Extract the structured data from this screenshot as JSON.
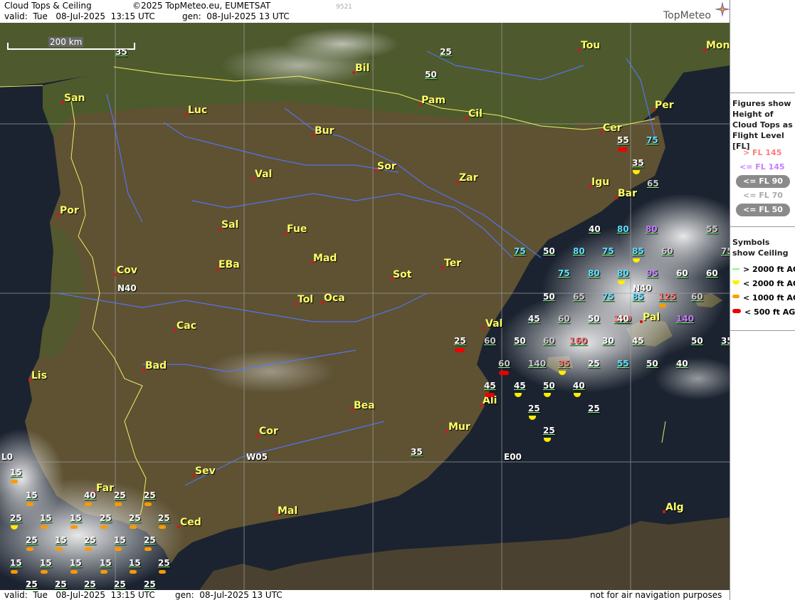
{
  "header": {
    "product": "Cloud Tops & Ceiling",
    "copyright": "©2025 TopMeteo.eu, EUMETSAT",
    "valid": "valid:  Tue   08-Jul-2025  13:15 UTC",
    "gen": "gen:  08-Jul-2025 13 UTC",
    "code": "9521",
    "brand": "TopMeteo"
  },
  "footer": {
    "valid": "valid:  Tue   08-Jul-2025  13:15 UTC",
    "gen": "gen:  08-Jul-2025 13 UTC",
    "disclaimer": "not for air navigation purposes"
  },
  "scale": "200 km",
  "grid_labels": [
    {
      "id": "n40",
      "text": "N40"
    },
    {
      "id": "n40e",
      "text": "N40"
    },
    {
      "id": "w05",
      "text": "W05"
    },
    {
      "id": "e00",
      "text": "E00"
    },
    {
      "id": "l0",
      "text": "L0"
    }
  ],
  "cities": [
    {
      "name": "San"
    },
    {
      "name": "Luc"
    },
    {
      "name": "Bil"
    },
    {
      "name": "Pam"
    },
    {
      "name": "Cil"
    },
    {
      "name": "Tou"
    },
    {
      "name": "Mon"
    },
    {
      "name": "Per"
    },
    {
      "name": "Cer"
    },
    {
      "name": "Bur"
    },
    {
      "name": "Val"
    },
    {
      "name": "Sor"
    },
    {
      "name": "Zar"
    },
    {
      "name": "Igu"
    },
    {
      "name": "Bar"
    },
    {
      "name": "Por"
    },
    {
      "name": "Sal"
    },
    {
      "name": "Fue"
    },
    {
      "name": "Cov"
    },
    {
      "name": "EBa"
    },
    {
      "name": "Mad"
    },
    {
      "name": "Tol"
    },
    {
      "name": "Oca"
    },
    {
      "name": "Sot"
    },
    {
      "name": "Ter"
    },
    {
      "name": "Cac"
    },
    {
      "name": "Bad"
    },
    {
      "name": "Val"
    },
    {
      "name": "Lis"
    },
    {
      "name": "Ali"
    },
    {
      "name": "Bea"
    },
    {
      "name": "Mur"
    },
    {
      "name": "Cor"
    },
    {
      "name": "Sev"
    },
    {
      "name": "Far"
    },
    {
      "name": "Ced"
    },
    {
      "name": "Mal"
    },
    {
      "name": "Alg"
    },
    {
      "name": "Pal"
    }
  ],
  "flight_levels": [
    "35",
    "25",
    "50",
    "55",
    "75",
    "35",
    "65",
    "40",
    "80",
    "80",
    "55",
    "75",
    "50",
    "80",
    "75",
    "85",
    "60",
    "75",
    "75",
    "80",
    "80",
    "95",
    "60",
    "60",
    "50",
    "65",
    "75",
    "85",
    "125",
    "60",
    "45",
    "60",
    "50",
    "170",
    "40",
    "140",
    "25",
    "60",
    "50",
    "60",
    "160",
    "30",
    "45",
    "50",
    "35",
    "35",
    "60",
    "140",
    "25",
    "55",
    "50",
    "40",
    "40",
    "45",
    "45",
    "50",
    "40",
    "25",
    "25",
    "25",
    "35",
    "15",
    "15",
    "40",
    "25",
    "25",
    "25",
    "15",
    "15",
    "25",
    "25",
    "25",
    "25",
    "15",
    "25",
    "15",
    "25",
    "15",
    "15",
    "15",
    "15",
    "15",
    "25",
    "15",
    "15",
    "25",
    "25",
    "25",
    "25",
    "25"
  ],
  "legend": {
    "figures_title": "Figures show Height of Cloud Tops as Flight Level  [FL]",
    "fl_items": [
      {
        "label": "> FL 145",
        "color": "#ff7b7b"
      },
      {
        "label": "<= FL 145",
        "color": "#c77dff"
      }
    ],
    "pills": [
      {
        "label": "<= FL 90"
      },
      {
        "label": "<= FL 70"
      },
      {
        "label": "<= FL 50"
      }
    ],
    "symbols_title": "Symbols show Ceiling",
    "sym_items": [
      {
        "label": "> 2000 ft AGL",
        "color": "#7CFF7C"
      },
      {
        "label": "< 2000 ft AGL",
        "color": "#ffee00"
      },
      {
        "label": "< 1000 ft AGL",
        "color": "#ff9900"
      },
      {
        "label": "< 500 ft AGL",
        "color": "#ee0000"
      }
    ]
  },
  "colors": {
    "city": "#ffff66",
    "border": "#ffff66",
    "river": "#5577ff",
    "land": "#5a5030",
    "sea": "#1b2330"
  }
}
